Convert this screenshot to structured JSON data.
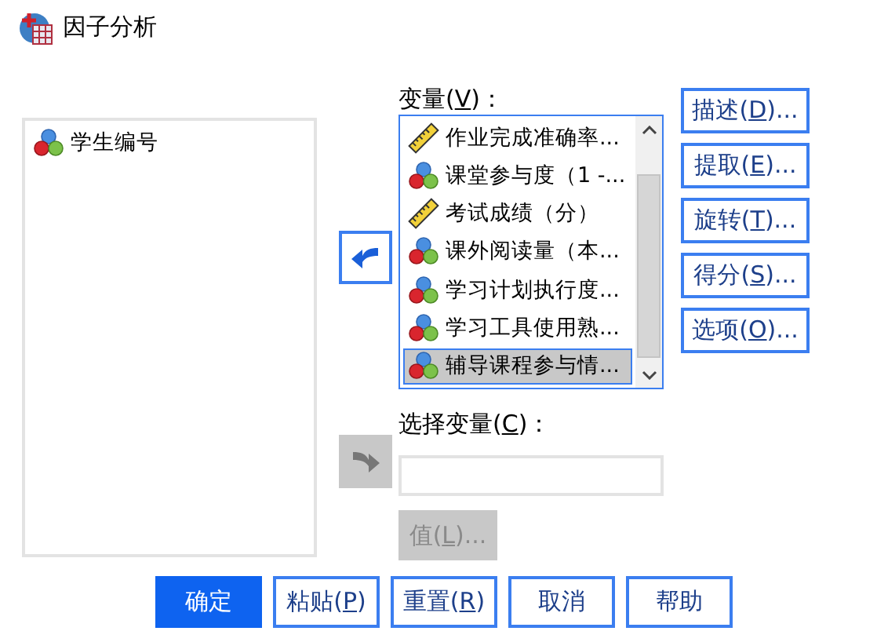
{
  "window": {
    "title": "因子分析"
  },
  "source_list": {
    "items": [
      {
        "label": "学生编号",
        "kind": "nominal",
        "selected": false
      }
    ]
  },
  "variables": {
    "label": {
      "text": "变量(",
      "mnemonic": "V",
      "rest": ")："
    },
    "items": [
      {
        "label": "作业完成准确率...",
        "kind": "scale",
        "selected": false
      },
      {
        "label": "课堂参与度（1 -...",
        "kind": "nominal",
        "selected": false
      },
      {
        "label": "考试成绩（分）",
        "kind": "scale",
        "selected": false
      },
      {
        "label": "课外阅读量（本...",
        "kind": "nominal",
        "selected": false
      },
      {
        "label": "学习计划执行度...",
        "kind": "nominal",
        "selected": false
      },
      {
        "label": "学习工具使用熟...",
        "kind": "nominal",
        "selected": false
      },
      {
        "label": "辅导课程参与情...",
        "kind": "nominal",
        "selected": true
      }
    ]
  },
  "move_buttons": [
    {
      "kind": "left",
      "disabled": false
    },
    {
      "kind": "right",
      "disabled": true
    }
  ],
  "selection": {
    "label": {
      "text": "选择变量(",
      "mnemonic": "C",
      "rest": ")："
    }
  },
  "value_button": {
    "text": "值(",
    "mnemonic": "L",
    "rest": ")...",
    "disabled": true
  },
  "side_buttons": [
    {
      "text": "描述(",
      "mnemonic": "D",
      "rest": ")..."
    },
    {
      "text": "提取(",
      "mnemonic": "E",
      "rest": ")..."
    },
    {
      "text": "旋转(",
      "mnemonic": "T",
      "rest": ")..."
    },
    {
      "text": "得分(",
      "mnemonic": "S",
      "rest": ")..."
    },
    {
      "text": "选项(",
      "mnemonic": "O",
      "rest": ")..."
    }
  ],
  "footer_buttons": [
    {
      "text": "确定",
      "default": true
    },
    {
      "text": "粘贴(",
      "mnemonic": "P",
      "rest": ")",
      "default": false
    },
    {
      "text": "重置(",
      "mnemonic": "R",
      "rest": ")",
      "default": false
    },
    {
      "text": "取消",
      "default": false
    },
    {
      "text": "帮助",
      "default": false
    }
  ]
}
